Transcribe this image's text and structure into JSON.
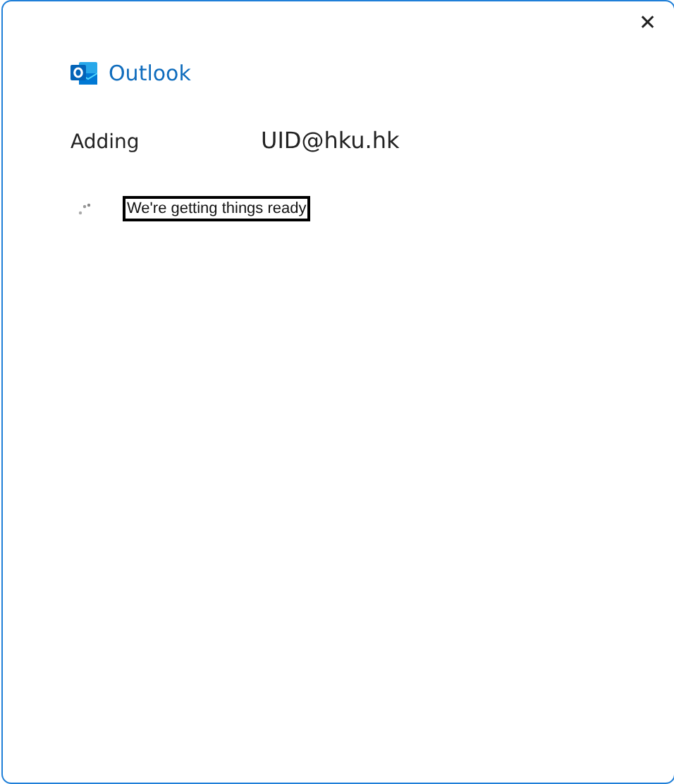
{
  "window": {
    "close_glyph": "✕"
  },
  "brand": {
    "name": "Outlook"
  },
  "account": {
    "label": "Adding",
    "email": "UID@hku.hk"
  },
  "status": {
    "text": "We're getting things ready",
    "focused": true
  }
}
